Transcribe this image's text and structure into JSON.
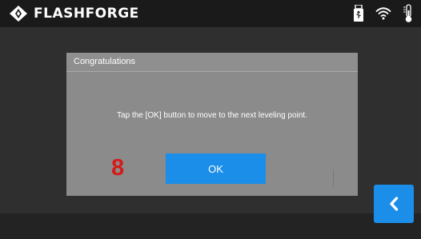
{
  "header": {
    "brand_name": "FLASHFORGE",
    "logo_icon": "flashforge-logo-icon",
    "status_icons": [
      "usb-icon",
      "wifi-icon",
      "thermometer-icon"
    ]
  },
  "dialog": {
    "title": "Congratulations",
    "message": "Tap the [OK] button to move to the next leveling point.",
    "step_number": "8",
    "ok_label": "OK"
  },
  "navigation": {
    "back_icon": "chevron-left-icon"
  },
  "colors": {
    "accent": "#1a8ee8",
    "step_number": "#d61a1a",
    "dialog_background": "#8b8b8b",
    "topbar_background": "#1a1a1a"
  }
}
